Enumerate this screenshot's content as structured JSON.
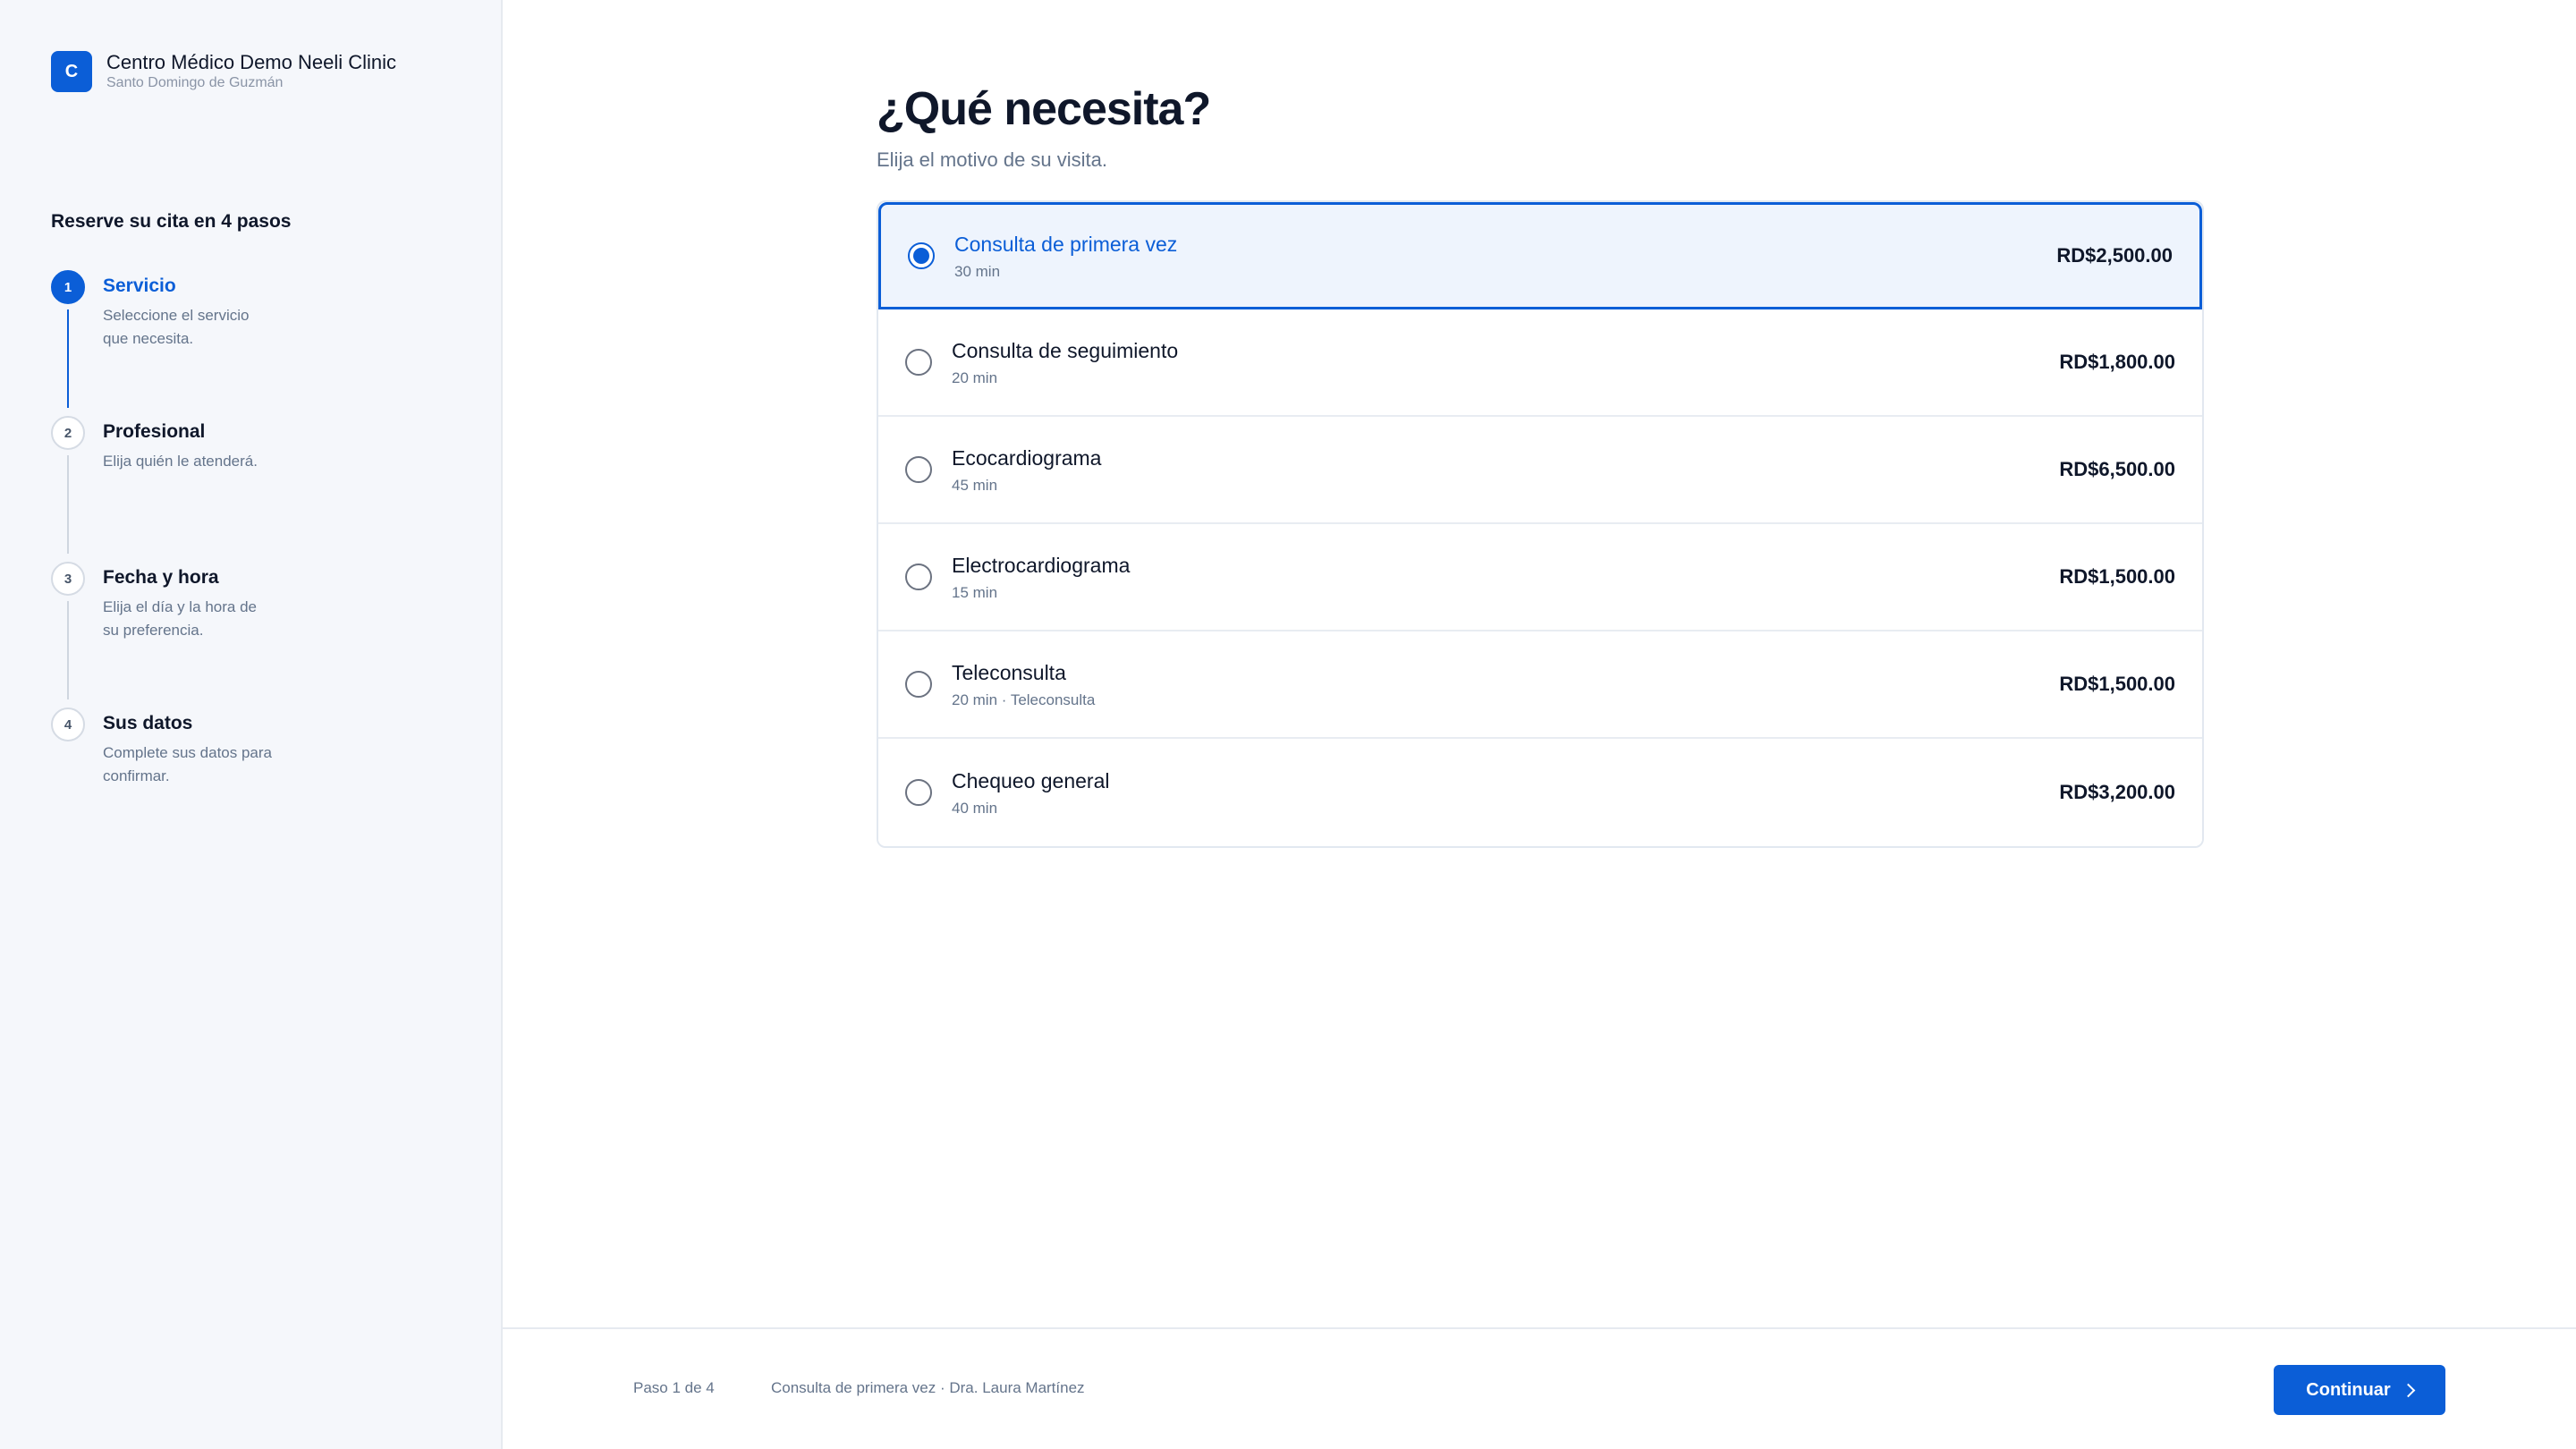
{
  "brand": {
    "logo_letter": "C",
    "name": "Centro Médico Demo Neeli Clinic",
    "city": "Santo Domingo de Guzmán"
  },
  "sidebar": {
    "steps_title": "Reserve su cita en 4 pasos",
    "steps": [
      {
        "num": "1",
        "label": "Servicio",
        "desc": "Seleccione el servicio que necesita."
      },
      {
        "num": "2",
        "label": "Profesional",
        "desc": "Elija quién le atenderá."
      },
      {
        "num": "3",
        "label": "Fecha y hora",
        "desc": "Elija el día y la hora de su preferencia."
      },
      {
        "num": "4",
        "label": "Sus datos",
        "desc": "Complete sus datos para confirmar."
      }
    ]
  },
  "main": {
    "title": "¿Qué necesita?",
    "subtitle": "Elija el motivo de su visita.",
    "services": [
      {
        "name": "Consulta de primera vez",
        "meta": "30 min",
        "price": "RD$2,500.00"
      },
      {
        "name": "Consulta de seguimiento",
        "meta": "20 min",
        "price": "RD$1,800.00"
      },
      {
        "name": "Ecocardiograma",
        "meta": "45 min",
        "price": "RD$6,500.00"
      },
      {
        "name": "Electrocardiograma",
        "meta": "15 min",
        "price": "RD$1,500.00"
      },
      {
        "name": "Teleconsulta",
        "meta": "20 min · Teleconsulta",
        "price": "RD$1,500.00"
      },
      {
        "name": "Chequeo general",
        "meta": "40 min",
        "price": "RD$3,200.00"
      }
    ]
  },
  "footer": {
    "step_text": "Paso 1 de 4",
    "summary": "Consulta de primera vez · Dra. Laura Martínez",
    "continue_label": "Continuar"
  },
  "colors": {
    "accent": "#0b5ed7",
    "sidebar_bg": "#f5f7fb"
  },
  "icons": {
    "continue": "chevron-right-icon"
  }
}
